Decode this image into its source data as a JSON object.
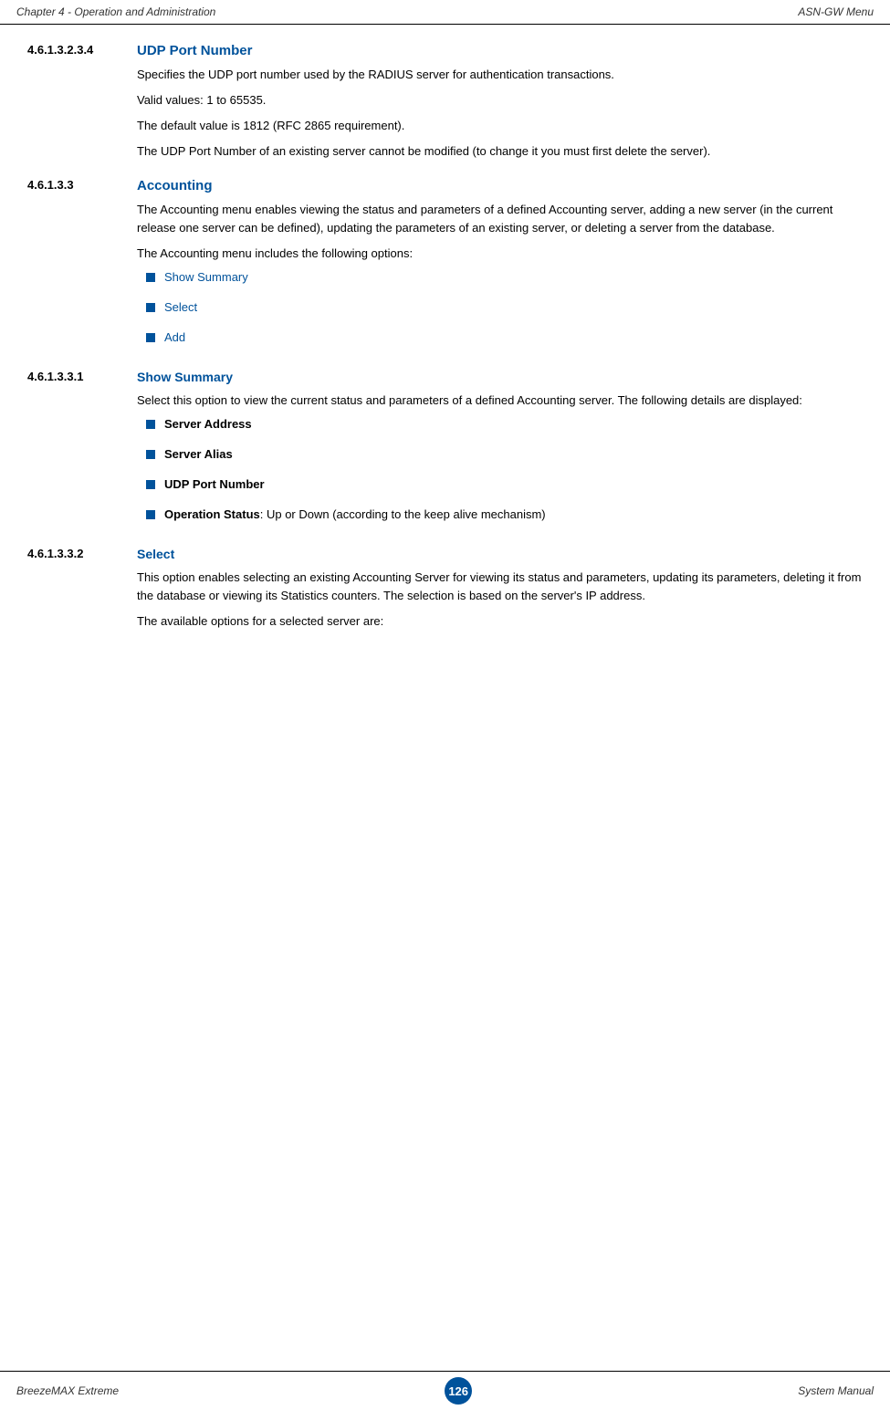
{
  "header": {
    "left": "Chapter 4 - Operation and Administration",
    "right": "ASN-GW Menu"
  },
  "footer": {
    "left": "BreezeMAX Extreme",
    "center": "126",
    "right": "System Manual"
  },
  "sections": [
    {
      "id": "s4613234",
      "num": "4.6.1.3.2.3.4",
      "title": "UDP Port Number",
      "paragraphs": [
        "Specifies the UDP port number used by the RADIUS server for authentication transactions.",
        "Valid values: 1 to 65535.",
        "The default value is 1812 (RFC 2865 requirement).",
        "The UDP Port Number of an existing server cannot be modified (to change it you must first delete the server)."
      ]
    },
    {
      "id": "s46133",
      "num": "4.6.1.3.3",
      "title": "Accounting",
      "paragraphs": [
        "The Accounting menu enables viewing the status and parameters of a defined Accounting server, adding a new server (in the current release one server can be defined), updating the parameters of an existing server, or deleting a server from the database.",
        "The Accounting menu includes the following options:"
      ],
      "bullets": [
        {
          "text": "Show Summary",
          "type": "link"
        },
        {
          "text": "Select",
          "type": "link"
        },
        {
          "text": "Add",
          "type": "link"
        }
      ]
    },
    {
      "id": "s461331",
      "num": "4.6.1.3.3.1",
      "title": "Show Summary",
      "paragraphs": [
        "Select this option to view the current status and parameters of a defined Accounting server. The following details are displayed:"
      ],
      "bullets": [
        {
          "text": "Server Address",
          "type": "bold-black"
        },
        {
          "text": "Server Alias",
          "type": "bold-black"
        },
        {
          "text": "UDP Port Number",
          "type": "bold-black"
        },
        {
          "text": "Operation Status",
          "suffix": ": Up or Down (according to the keep alive mechanism)",
          "type": "bold-mixed"
        }
      ]
    },
    {
      "id": "s461332",
      "num": "4.6.1.3.3.2",
      "title": "Select",
      "paragraphs": [
        "This option enables selecting an existing Accounting Server for viewing its status and parameters, updating its parameters, deleting it from the database or viewing its Statistics counters. The selection is based on the server's IP address.",
        "The available options for a selected server are:"
      ]
    }
  ]
}
